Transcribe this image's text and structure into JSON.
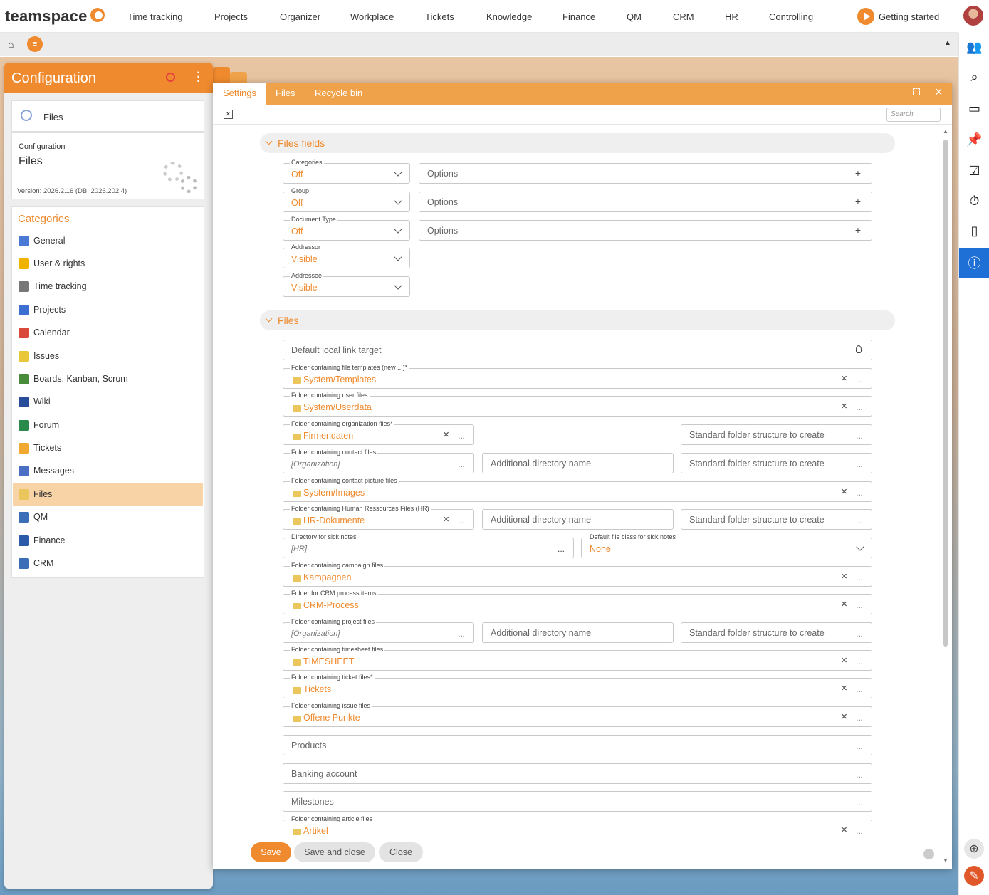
{
  "app": {
    "logo": "teamspace",
    "getting_started": "Getting started"
  },
  "nav": [
    "Time tracking",
    "Projects",
    "Organizer",
    "Workplace",
    "Tickets",
    "Knowledge",
    "Finance",
    "QM",
    "CRM",
    "HR",
    "Controlling"
  ],
  "config": {
    "title": "Configuration",
    "module": "Files",
    "info_label": "Configuration",
    "info_title": "Files",
    "version": "Version: 2026.2.16 (DB: 2026.202.4)",
    "categories_title": "Categories",
    "categories": [
      "General",
      "User & rights",
      "Time tracking",
      "Projects",
      "Calendar",
      "Issues",
      "Boards, Kanban, Scrum",
      "Wiki",
      "Forum",
      "Tickets",
      "Messages",
      "Files",
      "QM",
      "Finance",
      "CRM"
    ],
    "category_colors": [
      "#4a7ad6",
      "#f0b400",
      "#777777",
      "#3d6fd1",
      "#d94a3a",
      "#e8c83a",
      "#4a8b3b",
      "#2a4d9b",
      "#2a8a4b",
      "#f0a830",
      "#4a6fc4",
      "#ebc65c",
      "#3a6fb8",
      "#2a5aa8",
      "#3a6fb8"
    ]
  },
  "dialog": {
    "tabs": [
      "Settings",
      "Files",
      "Recycle bin"
    ],
    "search_placeholder": "Search",
    "section1": "Files fields",
    "section2": "Files",
    "dropdowns": [
      {
        "label": "Categories",
        "value": "Off"
      },
      {
        "label": "Group",
        "value": "Off"
      },
      {
        "label": "Document Type",
        "value": "Off"
      },
      {
        "label": "Addressor",
        "value": "Visible"
      },
      {
        "label": "Addressee",
        "value": "Visible"
      }
    ],
    "options_placeholder": "Options",
    "default_link": "Default local link target",
    "templates": {
      "label": "Folder containing file templates (new ...)*",
      "value": "System/Templates"
    },
    "userfiles": {
      "label": "Folder containing user files",
      "value": "System/Userdata"
    },
    "org": {
      "label": "Folder containing organization files*",
      "value": "Firmendaten"
    },
    "contact": {
      "label": "Folder containing contact files",
      "value": "[Organization]"
    },
    "contactpic": {
      "label": "Folder containing contact picture files",
      "value": "System/Images"
    },
    "hr": {
      "label": "Folder containing Human Ressources Files (HR)",
      "value": "HR-Dokumente"
    },
    "sick": {
      "label": "Directory for sick notes",
      "value": "[HR]"
    },
    "sickclass": {
      "label": "Default file class for sick notes",
      "value": "None"
    },
    "campaign": {
      "label": "Folder containing campaign files",
      "value": "Kampagnen"
    },
    "crm": {
      "label": "Folder for CRM process items",
      "value": "CRM-Process"
    },
    "project": {
      "label": "Folder containing project files",
      "value": "[Organization]"
    },
    "timesheet": {
      "label": "Folder containing timesheet files",
      "value": "TIMESHEET"
    },
    "ticket": {
      "label": "Folder containing ticket files*",
      "value": "Tickets"
    },
    "issue": {
      "label": "Folder containing issue files",
      "value": "Offene Punkte"
    },
    "products": "Products",
    "banking": "Banking account",
    "milestones": "Milestones",
    "article": {
      "label": "Folder containing article files",
      "value": "Artikel"
    },
    "additional_dir": "Additional directory name",
    "std_folder": "Standard folder structure to create",
    "buttons": {
      "save": "Save",
      "save_close": "Save and close",
      "close": "Close"
    }
  }
}
